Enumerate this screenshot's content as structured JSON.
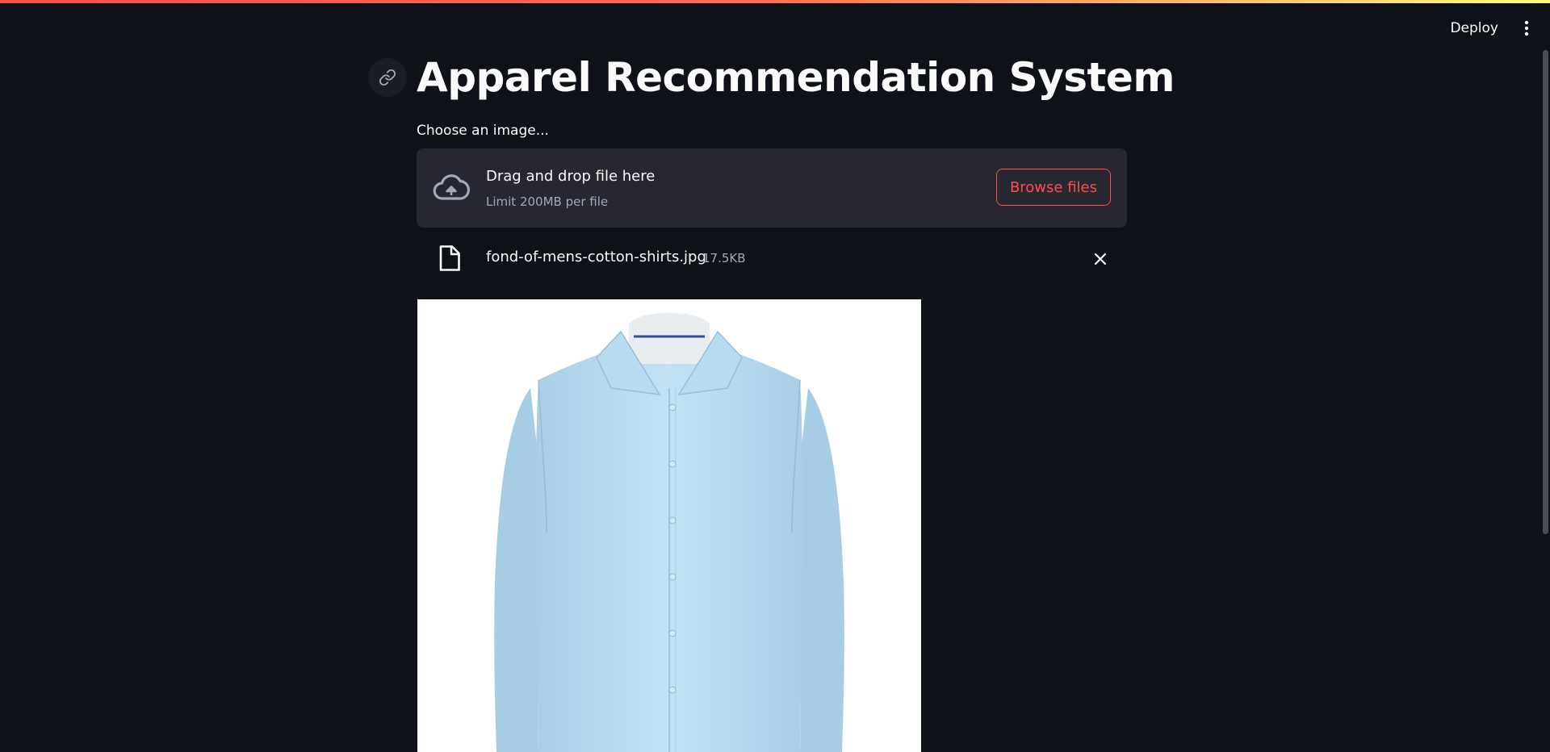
{
  "header": {
    "deploy_label": "Deploy",
    "menu_icon": "vertical-ellipsis-icon"
  },
  "main": {
    "title": "Apparel Recommendation System",
    "anchor_icon": "link-icon"
  },
  "uploader": {
    "label": "Choose an image...",
    "drop_title": "Drag and drop file here",
    "drop_limit": "Limit 200MB per file",
    "browse_label": "Browse files",
    "upload_icon": "cloud-upload-icon"
  },
  "uploaded_file": {
    "name": "fond-of-mens-cotton-shirts.jpg",
    "size": "17.5KB",
    "file_icon": "file-icon",
    "remove_icon": "close-icon"
  },
  "preview": {
    "subject": "light blue men's dress shirt"
  },
  "colors": {
    "background": "#0e1117",
    "surface": "#262730",
    "accent": "#ff4b4b",
    "text": "#fafafa",
    "muted_text": "#a3a8b8",
    "shirt": "#b9dcf0"
  }
}
